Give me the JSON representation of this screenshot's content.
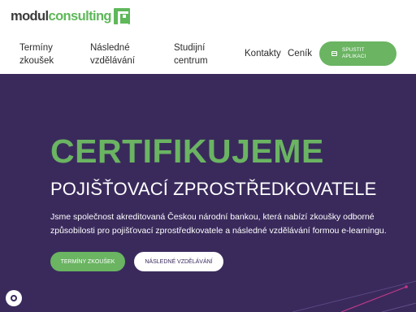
{
  "logo": {
    "part1": "modul",
    "part2": "consulting"
  },
  "nav": {
    "terminy": "Termíny zkoušek",
    "nasledne": "Následné vzdělávání",
    "studijni": "Studijní centrum",
    "kontakty": "Kontakty",
    "cenik": "Ceník"
  },
  "app_button": {
    "label": "Spustit aplikaci",
    "icon": "app-window-icon"
  },
  "hero": {
    "title": "CERTIFIKUJEME",
    "subtitle": "POJIŠŤOVACÍ ZPROSTŘEDKOVATELE",
    "text": "Jsme společnost akreditovaná Českou národní bankou, která nabízí zkoušky odborné způsobilosti pro pojišťovací zprostředkovatele a následné vzdělávání formou e-learningu.",
    "primary_button": "Termíny zkoušek",
    "secondary_button": "Následné vzdělávání"
  },
  "colors": {
    "brand_green": "#6ab462",
    "hero_purple": "#3a2a5c",
    "accent_pink": "#c0398a"
  },
  "cookie_icon": "cookie-settings-icon"
}
